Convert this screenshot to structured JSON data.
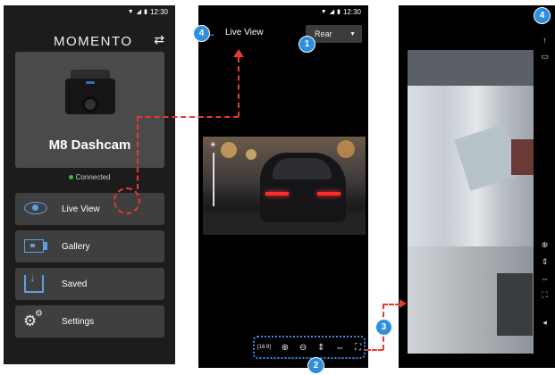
{
  "status_bar": {
    "time": "12:30"
  },
  "home": {
    "brand": "MOMENTO",
    "device_name": "M8 Dashcam",
    "connection_status": "Connected",
    "menu": [
      {
        "label": "Live View",
        "icon": "eye-icon"
      },
      {
        "label": "Gallery",
        "icon": "gallery-icon"
      },
      {
        "label": "Saved",
        "icon": "download-icon"
      },
      {
        "label": "Settings",
        "icon": "gear-icon"
      }
    ]
  },
  "live_view": {
    "title": "Live View",
    "camera_select": {
      "selected": "Rear"
    },
    "toolbar": [
      {
        "icon": "aspect-ratio-icon",
        "glyph": "[16:9]"
      },
      {
        "icon": "zoom-in-icon",
        "glyph": "⊕"
      },
      {
        "icon": "zoom-out-icon",
        "glyph": "⊖"
      },
      {
        "icon": "flip-vertical-icon",
        "glyph": "⇕"
      },
      {
        "icon": "mirror-icon",
        "glyph": "⇔"
      },
      {
        "icon": "fullscreen-icon",
        "glyph": "⛶"
      }
    ]
  },
  "badges": {
    "b1": "1",
    "b2": "2",
    "b3": "3",
    "b4": "4"
  },
  "colors": {
    "accent": "#2e8fde",
    "connected": "#2fbf3a",
    "annotation": "#e53935"
  }
}
